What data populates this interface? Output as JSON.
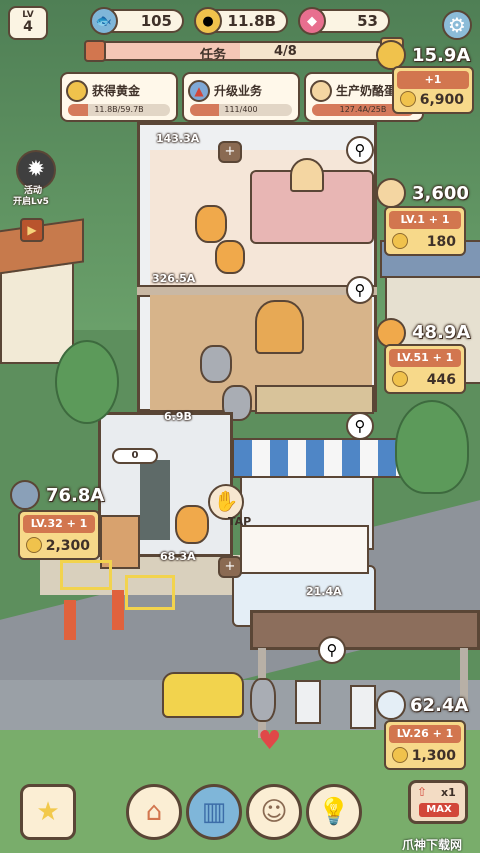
{
  "player": {
    "level_label": "LV",
    "level": "4"
  },
  "resources": {
    "fish": {
      "icon": "fish-icon",
      "value": "105"
    },
    "coins": {
      "icon": "coin-icon",
      "value": "11.8B"
    },
    "gems": {
      "icon": "gem-icon",
      "value": "53"
    }
  },
  "task": {
    "label": "任务",
    "progress": "4/8",
    "fraction": 0.5
  },
  "quests": [
    {
      "title": "获得黄金",
      "value": "11.8B/59.7B",
      "fraction": 0.2,
      "icon": "coin-icon"
    },
    {
      "title": "升级业务",
      "value": "111/400",
      "fraction": 0.28,
      "icon": "upgrade-arrow-icon"
    },
    {
      "title": "生产奶酪蛋糕",
      "value": "127.4A/25B",
      "fraction": 1.0,
      "icon": "cheesecake-icon"
    }
  ],
  "event": {
    "line1": "活动",
    "line2": "开启Lv5"
  },
  "floors": [
    {
      "label": "143.3A"
    },
    {
      "label": "326.5A"
    },
    {
      "label": "6.9B"
    },
    {
      "label": "68.3A"
    },
    {
      "label": "21.4A"
    }
  ],
  "counter": {
    "value": "0"
  },
  "tap_label": "TAP",
  "businesses": [
    {
      "income": "15.9A",
      "upgrade": "+1",
      "cost": "6,900"
    },
    {
      "income": "3,600",
      "upgrade": "LV.1 + 1",
      "cost": "180"
    },
    {
      "income": "48.9A",
      "upgrade": "LV.51 + 1",
      "cost": "446"
    },
    {
      "income": "76.8A",
      "upgrade": "LV.32 + 1",
      "cost": "2,300"
    },
    {
      "income": "62.4A",
      "upgrade": "LV.26 + 1",
      "cost": "1,300"
    }
  ],
  "boost": {
    "multiplier": "x1",
    "max": "MAX"
  },
  "watermark": "爪神下载网",
  "colors": {
    "accent": "#d2764f",
    "outline": "#5a4636",
    "panel": "#fbf4e3",
    "gold": "#f0c24c"
  }
}
